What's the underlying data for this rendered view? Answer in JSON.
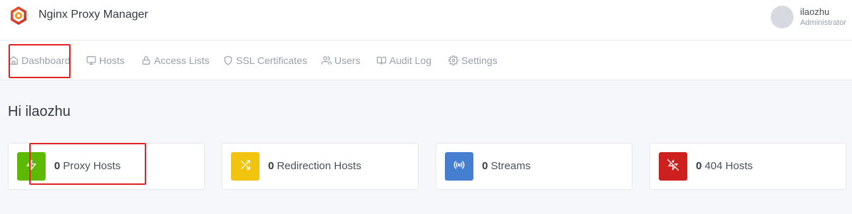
{
  "header": {
    "app_title": "Nginx Proxy Manager",
    "logo_icon": "nginx-proxy-manager-logo",
    "user": {
      "name": "ilaozhu",
      "role": "Administrator"
    }
  },
  "nav": {
    "items": [
      {
        "label": "Dashboard",
        "icon": "home-icon",
        "active": true
      },
      {
        "label": "Hosts",
        "icon": "monitor-icon"
      },
      {
        "label": "Access Lists",
        "icon": "lock-icon"
      },
      {
        "label": "SSL Certificates",
        "icon": "shield-icon"
      },
      {
        "label": "Users",
        "icon": "users-icon"
      },
      {
        "label": "Audit Log",
        "icon": "book-icon"
      },
      {
        "label": "Settings",
        "icon": "gear-icon"
      }
    ]
  },
  "main": {
    "greeting": "Hi ilaozhu",
    "cards": [
      {
        "count": "0",
        "label": "Proxy Hosts",
        "icon": "zap-icon",
        "color": "#5eba00"
      },
      {
        "count": "0",
        "label": "Redirection Hosts",
        "icon": "shuffle-icon",
        "color": "#f1c40f"
      },
      {
        "count": "0",
        "label": "Streams",
        "icon": "radio-icon",
        "color": "#467fcf"
      },
      {
        "count": "0",
        "label": "404 Hosts",
        "icon": "zap-off-icon",
        "color": "#cd201f"
      }
    ]
  },
  "colors": {
    "highlight": "#e02424",
    "nav_text": "#9aa0ac",
    "background": "#f5f7fb"
  }
}
